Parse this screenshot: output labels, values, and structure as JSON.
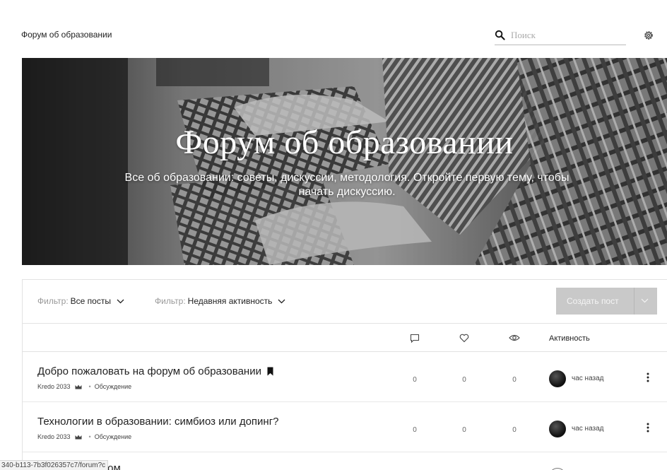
{
  "header": {
    "site_title": "Форум об образовании",
    "search_placeholder": "Поиск"
  },
  "hero": {
    "title": "Форум об образовании",
    "description": "Все об образовании: советы, дискуссии, методология. Откройте первую тему, чтобы начать дискуссию."
  },
  "filters": [
    {
      "label": "Фильтр:",
      "value": "Все посты"
    },
    {
      "label": "Фильтр:",
      "value": "Недавняя активность"
    }
  ],
  "create_button": {
    "label": "Создать пост"
  },
  "columns": {
    "comments_icon": "comment-icon",
    "likes_icon": "heart-icon",
    "views_icon": "eye-icon",
    "activity": "Активность"
  },
  "posts": [
    {
      "title": "Добро пожаловать на форум об образовании",
      "pinned": true,
      "author": "Kredo 2033",
      "category": "Обсуждение",
      "comments": "0",
      "likes": "0",
      "views": "0",
      "activity": "час назад"
    },
    {
      "title": "Технологии в образовании: симбиоз или допинг?",
      "pinned": false,
      "author": "Kredo 2033",
      "category": "Обсуждение",
      "comments": "0",
      "likes": "0",
      "views": "0",
      "activity": "час назад"
    },
    {
      "title": "Делимся опытом",
      "pinned": false
    }
  ],
  "status_bar": {
    "url": "340-b113-7b3f026357c7/forum?c"
  }
}
